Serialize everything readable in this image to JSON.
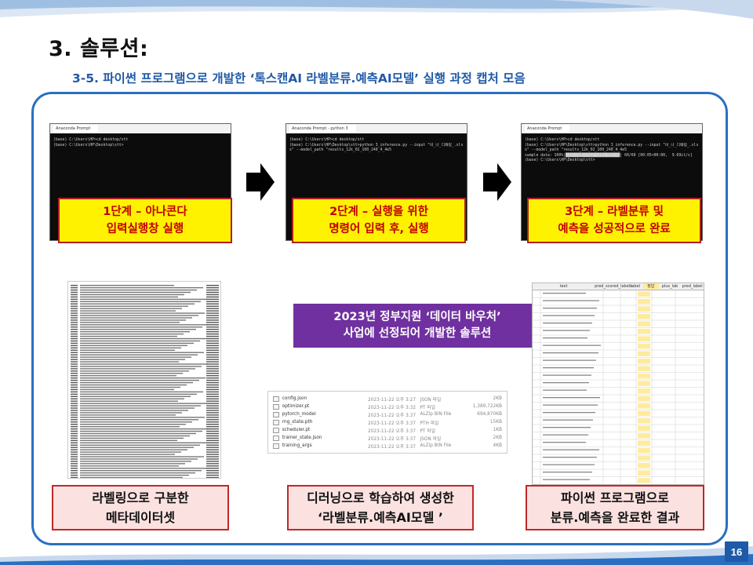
{
  "header": {
    "title": "3. 솔루션:",
    "subtitle": "3-5. 파이썬 프로그램으로 개발한 ‘톡스캔AI 라벨분류.예측AI모델’ 실행 과정 캡처 모음"
  },
  "page_number": "16",
  "terminals": [
    {
      "tab": "Anaconda Prompt",
      "lines": [
        "(base) C:\\Users\\HP>cd desktop/stt",
        "",
        "(base) C:\\Users\\HP\\Desktop\\stt>"
      ]
    },
    {
      "tab": "Anaconda Prompt - python 3",
      "lines": [
        "(base) C:\\Users\\HP>cd desktop/stt",
        "",
        "(base) C:\\Users\\HP\\Desktop\\stt>python 3_inference.py --input \"비_나_디패링_.xls",
        "x\" --model_path \"results_12k_02_100_240_4_4e5"
      ]
    },
    {
      "tab": "Anaconda Prompt",
      "lines": [
        "(base) C:\\Users\\HP>cd desktop/stt",
        "",
        "(base) C:\\Users\\HP\\Desktop\\stt>python 3_inference.py --input \"비_나_디패링_.xls",
        "x\" --model_path \"results_12k_02_100_240_4_4e5",
        "sample data: 100%|████████████████████████| 60/60 [00:05<00:00,  9.69it/s]",
        "",
        "(base) C:\\Users\\HP\\Desktop\\stt>"
      ]
    }
  ],
  "steps": [
    {
      "line1": "1단계 – 아나콘다",
      "line2": "입력실행창 실행"
    },
    {
      "line1": "2단계 – 실행을 위한",
      "line2": "명령어 입력 후, 실행"
    },
    {
      "line1": "3단계 – 라벨분류 및",
      "line2": "예측을 성공적으로 완료"
    }
  ],
  "purple_box": {
    "line1": "2023년 정부지원 ‘데이터 바우처’",
    "line2": "사업에 선정되어 개발한 솔루션"
  },
  "files": [
    {
      "name": "config.json",
      "date": "2023-11-22 오후 3:27",
      "type": "JSON 파일",
      "size": "2KB"
    },
    {
      "name": "optimizer.pt",
      "date": "2023-11-22 오후 3:32",
      "type": "PT 파일",
      "size": "1,389,722KB"
    },
    {
      "name": "pytorch_model",
      "date": "2023-11-22 오후 3:37",
      "type": "ALZip BIN File",
      "size": "694,870KB"
    },
    {
      "name": "rng_state.pth",
      "date": "2023-11-22 오후 3:37",
      "type": "PTH 파일",
      "size": "15KB"
    },
    {
      "name": "scheduler.pt",
      "date": "2023-11-22 오후 3:37",
      "type": "PT 파일",
      "size": "1KB"
    },
    {
      "name": "trainer_state.json",
      "date": "2023-11-22 오후 3:37",
      "type": "JSON 파일",
      "size": "2KB"
    },
    {
      "name": "training_args",
      "date": "2023-11-22 오후 3:37",
      "type": "ALZip BIN File",
      "size": "4KB"
    }
  ],
  "sheet": {
    "headers": [
      "text",
      "pred_scored_labels",
      "label",
      "정답"
    ],
    "side_headers": [
      "plus_lab",
      "pred_label"
    ]
  },
  "captions": [
    {
      "line1": "라벨링으로 구분한",
      "line2": "메타데이터셋"
    },
    {
      "line1": "디러닝으로 학습하여 생성한",
      "line2": "‘라벨분류.예측AI모델 ’"
    },
    {
      "line1": "파이썬 프로그램으로",
      "line2": "분류.예측을 완료한 결과"
    }
  ],
  "colors": {
    "accent_blue": "#2a6fc1",
    "step_yellow": "#fff200",
    "step_text_red": "#c00000",
    "caption_pink": "#fbe2e0",
    "purple": "#7030a0"
  }
}
